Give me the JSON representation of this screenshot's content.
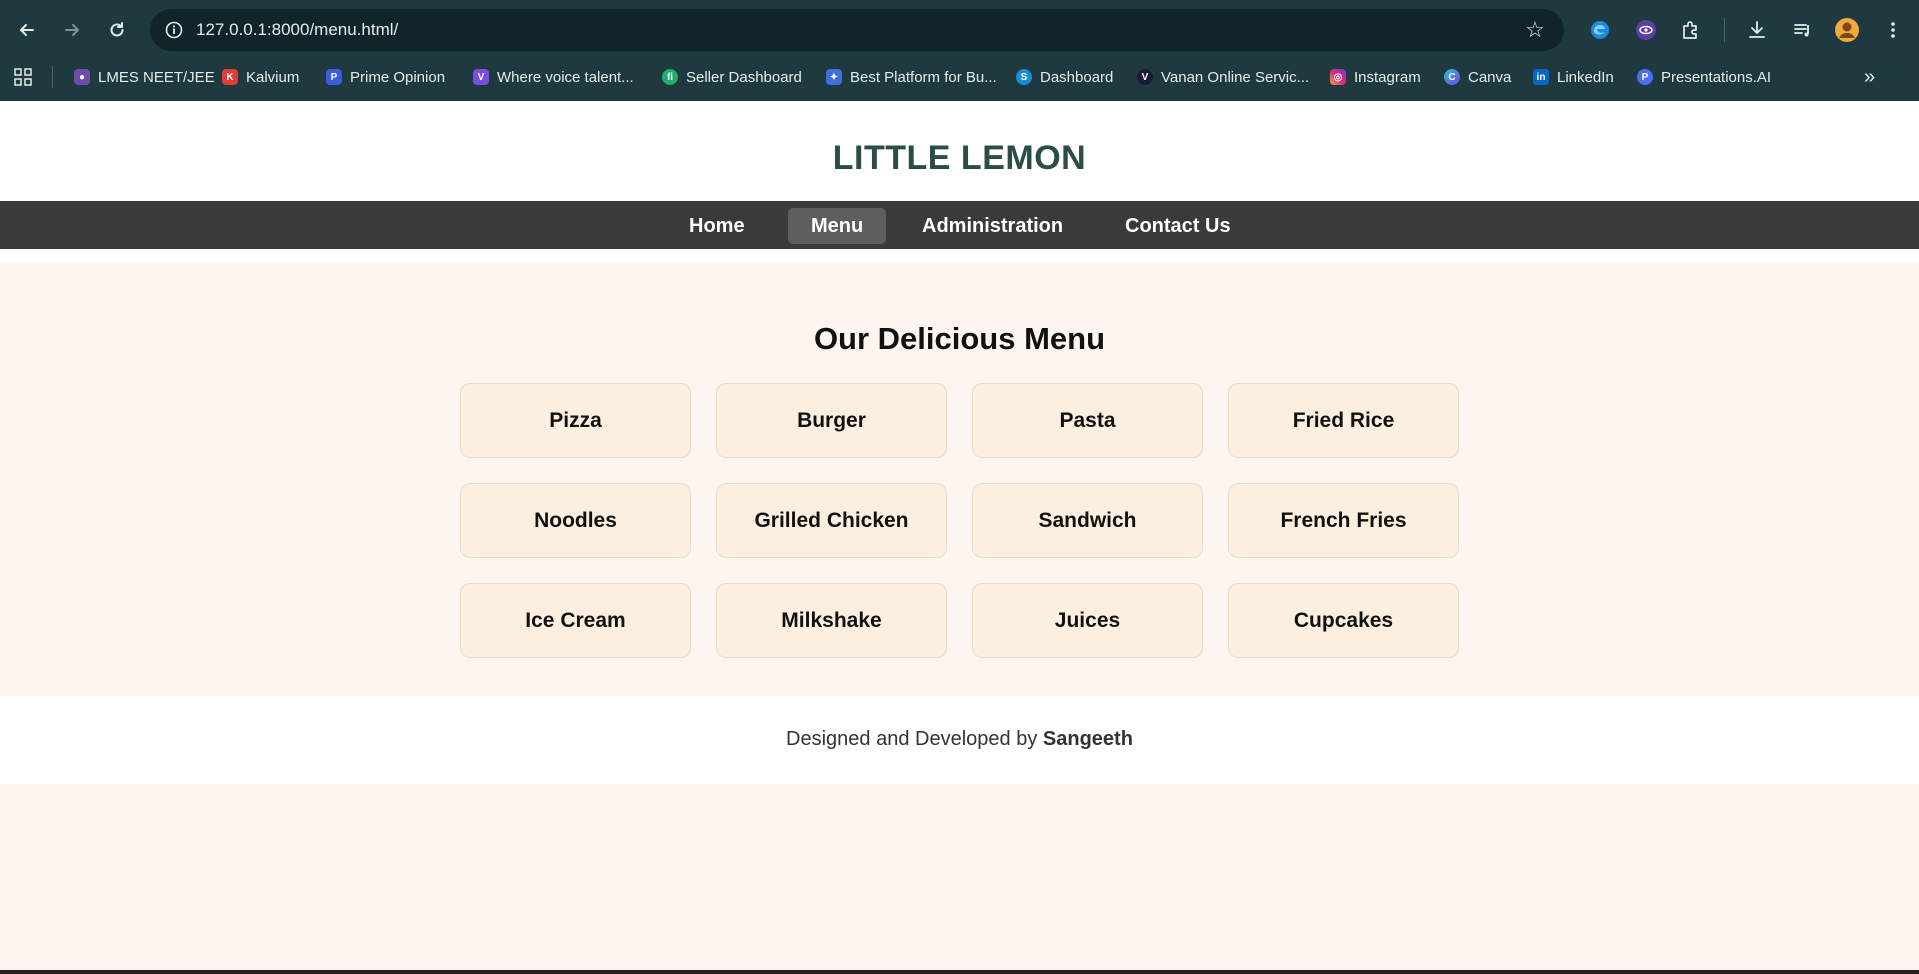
{
  "browser": {
    "url": "127.0.0.1:8000/menu.html/",
    "bookmarks": [
      {
        "label": "LMES NEET/JEE",
        "icon": "lmes-icon",
        "color": "#6b4ca6"
      },
      {
        "label": "Kalvium",
        "icon": "kalvium-icon",
        "color": "#e23b3b"
      },
      {
        "label": "Prime Opinion",
        "icon": "prime-opinion-icon",
        "color": "#3b5be2"
      },
      {
        "label": "Where voice talent...",
        "icon": "voice-talent-icon",
        "color": "#7a4de0"
      },
      {
        "label": "Seller Dashboard",
        "icon": "seller-dashboard-icon",
        "color": "#1fae6b"
      },
      {
        "label": "Best Platform for Bu...",
        "icon": "best-platform-icon",
        "color": "#3f6fd8"
      },
      {
        "label": "Dashboard",
        "icon": "dashboard-icon",
        "color": "#1b8fd6"
      },
      {
        "label": "Vanan Online Servic...",
        "icon": "vanan-icon",
        "color": "#1a1a3a"
      },
      {
        "label": "Instagram",
        "icon": "instagram-icon",
        "color": "#d6287c"
      },
      {
        "label": "Canva",
        "icon": "canva-icon",
        "color": "#7b3fe4"
      },
      {
        "label": "LinkedIn",
        "icon": "linkedin-icon",
        "color": "#0a66c2"
      },
      {
        "label": "Presentations.AI",
        "icon": "presentations-ai-icon",
        "color": "#4b6ef5"
      }
    ]
  },
  "page": {
    "brand": "LITTLE LEMON",
    "nav": [
      {
        "label": "Home",
        "active": false
      },
      {
        "label": "Menu",
        "active": true
      },
      {
        "label": "Administration",
        "active": false
      },
      {
        "label": "Contact Us",
        "active": false
      }
    ],
    "menu_title": "Our Delicious Menu",
    "menu_items": [
      "Pizza",
      "Burger",
      "Pasta",
      "Fried Rice",
      "Noodles",
      "Grilled Chicken",
      "Sandwich",
      "French Fries",
      "Ice Cream",
      "Milkshake",
      "Juices",
      "Cupcakes"
    ],
    "footer": {
      "prefix": "Designed and Developed by",
      "author": "Sangeeth"
    }
  },
  "colors": {
    "chrome": "#1f3a3f",
    "brand_text": "#2c4d45",
    "navbar": "#3a3a3a",
    "section_bg": "#fdf5f0",
    "card_bg": "#fdefe0"
  }
}
